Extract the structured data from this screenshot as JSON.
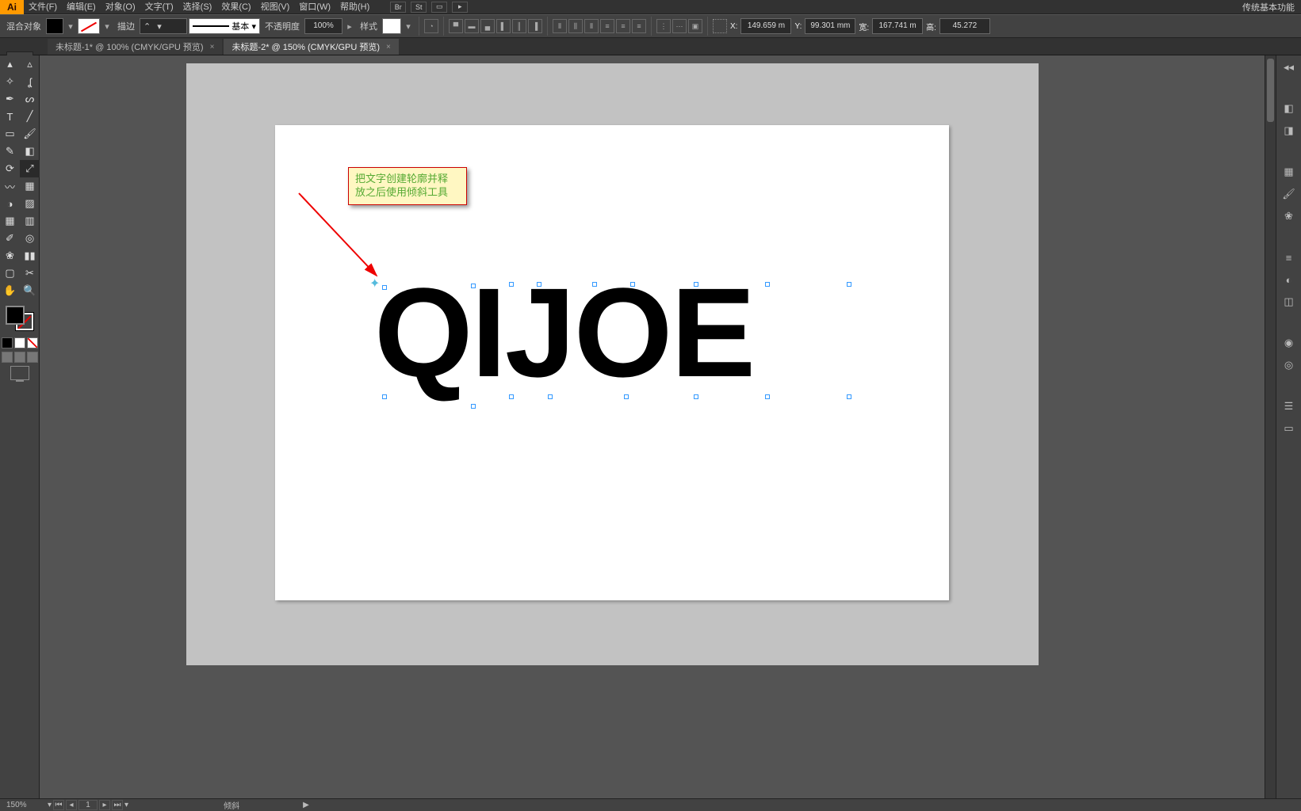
{
  "menubar": {
    "app_icon": "Ai",
    "items": [
      "文件(F)",
      "编辑(E)",
      "对象(O)",
      "文字(T)",
      "选择(S)",
      "效果(C)",
      "视图(V)",
      "窗口(W)",
      "帮助(H)"
    ],
    "workspace_label": "传统基本功能"
  },
  "options": {
    "context_label": "混合对象",
    "stroke_label": "描边",
    "stroke_weight": "",
    "dash_label": "基本",
    "opacity_label": "不透明度",
    "opacity_value": "100%",
    "style_label": "样式",
    "coords": {
      "x_label": "X:",
      "x_value": "149.659 m",
      "y_label": "Y:",
      "y_value": "99.301 mm",
      "w_label": "宽:",
      "w_value": "167.741 m",
      "h_label": "高:",
      "h_value": "45.272"
    }
  },
  "tabs": [
    {
      "label": "未标题-1* @ 100% (CMYK/GPU 预览)",
      "active": false
    },
    {
      "label": "未标题-2* @ 150% (CMYK/GPU 预览)",
      "active": true
    }
  ],
  "callout": {
    "line1": "把文字创建轮廓并释",
    "line2": "放之后使用倾斜工具"
  },
  "canvas": {
    "text": "QIJOE"
  },
  "statusbar": {
    "zoom": "150%",
    "artboard_num": "1",
    "tool_name": "倾斜",
    "play": "▶"
  },
  "tooltips": {
    "selection": "选择工具",
    "direct": "直接选择工具",
    "wand": "魔棒工具",
    "lasso": "套索工具",
    "pen": "钢笔工具",
    "curv": "曲率工具",
    "type": "文字工具",
    "line": "线段工具",
    "rect": "矩形工具",
    "brush": "画笔工具",
    "shaper": "Shaper工具",
    "eraser": "橡皮擦工具",
    "rotate": "旋转工具",
    "scale": "比例缩放工具",
    "width": "宽度工具",
    "free": "自由变换工具",
    "shape_builder": "形状生成器工具",
    "persp": "透视网格工具",
    "mesh": "网格工具",
    "gradient": "渐变工具",
    "eyedrop": "吸管工具",
    "blend": "混合工具",
    "symbol": "符号喷枪工具",
    "graph": "柱形图工具",
    "artboard": "画板工具",
    "slice": "切片工具",
    "hand": "抓手工具",
    "zoom": "缩放工具"
  }
}
